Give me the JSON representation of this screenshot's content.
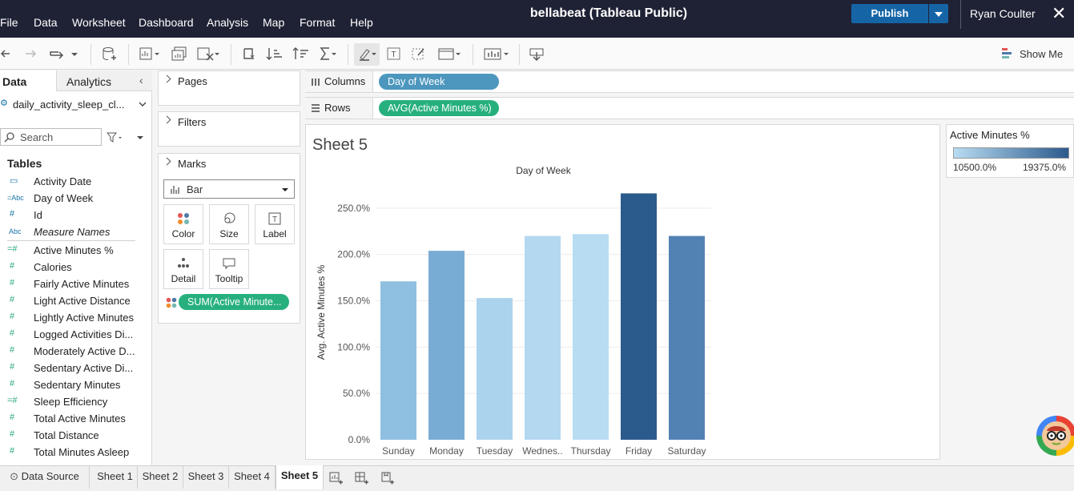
{
  "window": {
    "title": "bellabeat (Tableau Public)"
  },
  "menu": [
    "File",
    "Data",
    "Worksheet",
    "Dashboard",
    "Analysis",
    "Map",
    "Format",
    "Help"
  ],
  "header": {
    "publish_label": "Publish",
    "user_name": "Ryan Coulter"
  },
  "toolbar": {
    "show_me_label": "Show Me"
  },
  "data_pane": {
    "tab_data": "Data",
    "tab_analytics": "Analytics",
    "datasource": "daily_activity_sleep_cl...",
    "search_placeholder": "Search",
    "tables_heading": "Tables",
    "dimensions": [
      {
        "icon": "calendar-icon",
        "glyph": "▭",
        "label": "Activity Date"
      },
      {
        "icon": "string-icon",
        "glyph": "=Abc",
        "label": "Day of Week"
      },
      {
        "icon": "number-icon",
        "glyph": "#",
        "label": "Id"
      },
      {
        "icon": "string-icon",
        "glyph": "Abc",
        "label": "Measure Names"
      }
    ],
    "measures": [
      {
        "glyph": "=#",
        "label": "Active Minutes %"
      },
      {
        "glyph": "#",
        "label": "Calories"
      },
      {
        "glyph": "#",
        "label": "Fairly Active Minutes"
      },
      {
        "glyph": "#",
        "label": "Light Active Distance"
      },
      {
        "glyph": "#",
        "label": "Lightly Active Minutes"
      },
      {
        "glyph": "#",
        "label": "Logged Activities Di..."
      },
      {
        "glyph": "#",
        "label": "Moderately Active D..."
      },
      {
        "glyph": "#",
        "label": "Sedentary Active Di..."
      },
      {
        "glyph": "#",
        "label": "Sedentary Minutes"
      },
      {
        "glyph": "=#",
        "label": "Sleep Efficiency"
      },
      {
        "glyph": "#",
        "label": "Total Active Minutes"
      },
      {
        "glyph": "#",
        "label": "Total Distance"
      },
      {
        "glyph": "#",
        "label": "Total Minutes Asleep"
      }
    ]
  },
  "cards": {
    "pages_title": "Pages",
    "filters_title": "Filters",
    "marks_title": "Marks",
    "mark_type": "Bar",
    "mark_buttons": [
      "Color",
      "Size",
      "Label",
      "Detail",
      "Tooltip"
    ],
    "color_pill": "SUM(Active Minute..."
  },
  "shelves": {
    "columns_label": "Columns",
    "columns_pill": "Day of Week",
    "rows_label": "Rows",
    "rows_pill": "AVG(Active Minutes %)"
  },
  "sheet": {
    "title": "Sheet 5"
  },
  "legend": {
    "title": "Active Minutes %",
    "min_label": "10500.0%",
    "max_label": "19375.0%",
    "color_low": "#b8dcf2",
    "color_high": "#2b5a8c"
  },
  "chart_data": {
    "type": "bar",
    "title": "Day of Week",
    "xlabel": "",
    "ylabel": "Avg. Active Minutes %",
    "categories": [
      "Sunday",
      "Monday",
      "Tuesday",
      "Wednes..",
      "Thursday",
      "Friday",
      "Saturday"
    ],
    "values": [
      171,
      204,
      153,
      220,
      222,
      266,
      220
    ],
    "colors": [
      "#8fc0e1",
      "#79acd4",
      "#acd3ee",
      "#b3d8f0",
      "#b8dcf2",
      "#2b5a8c",
      "#5282b4"
    ],
    "yticks": [
      "0.0%",
      "50.0%",
      "100.0%",
      "150.0%",
      "200.0%",
      "250.0%"
    ],
    "ylim": [
      0,
      275
    ],
    "grid": true
  },
  "sheet_tabs": {
    "data_source": "Data Source",
    "tabs": [
      "Sheet 1",
      "Sheet 2",
      "Sheet 3",
      "Sheet 4",
      "Sheet 5"
    ],
    "active": "Sheet 5"
  }
}
